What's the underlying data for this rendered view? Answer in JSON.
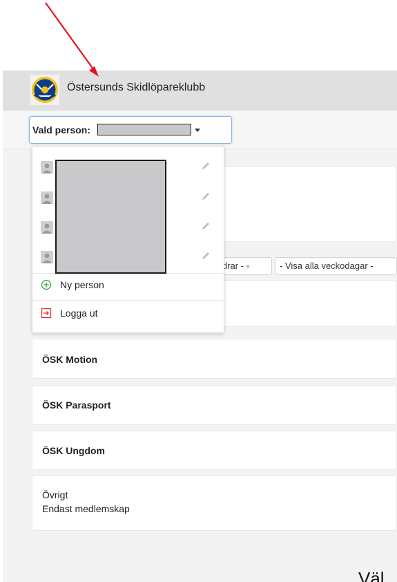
{
  "header": {
    "club_name": "Östersunds Skidlöpareklubb",
    "logo_icon": "club-crest-icon"
  },
  "person_selector": {
    "label": "Vald person:",
    "selected_value_redacted": true
  },
  "dropdown": {
    "persons": [
      {
        "name_redacted": true,
        "icon": "person-avatar-icon",
        "edit_icon": "pencil-icon"
      },
      {
        "name_redacted": true,
        "icon": "person-avatar-icon",
        "edit_icon": "pencil-icon"
      },
      {
        "name_redacted": true,
        "icon": "person-avatar-icon",
        "edit_icon": "pencil-icon"
      },
      {
        "name_redacted": true,
        "icon": "person-avatar-icon",
        "edit_icon": "pencil-icon"
      }
    ],
    "new_person_label": "Ny person",
    "logout_label": "Logga ut"
  },
  "filters": {
    "age_filter": "ldrar -",
    "weekday_filter": "- Visa alla veckodagar -"
  },
  "groups": [
    {
      "title": "ÖSK Motion"
    },
    {
      "title": "ÖSK Parasport"
    },
    {
      "title": "ÖSK Ungdom"
    },
    {
      "title": "Övrigt",
      "subtitle": "Endast medlemskap"
    }
  ],
  "bottom_text": "Väl",
  "colors": {
    "header_bg": "#e0e0e0",
    "accent_focus": "#8ab4e6",
    "new_person_green": "#3aa13a",
    "logout_red": "#e0312f",
    "annotation_arrow": "#e3141b"
  }
}
